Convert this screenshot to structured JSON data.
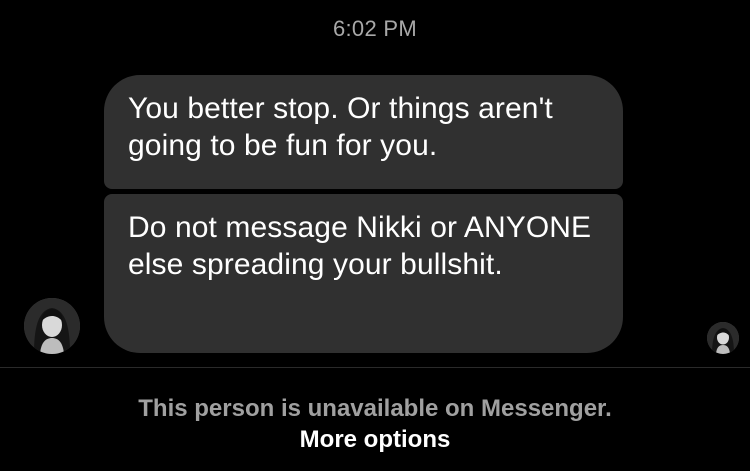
{
  "conversation": {
    "timestamp": "6:02 PM",
    "messages": [
      {
        "text": "You better stop. Or things aren't going to be fun for you."
      },
      {
        "text": "Do not message Nikki or ANYONE else spreading your bullshit."
      }
    ]
  },
  "footer": {
    "status": "This person is unavailable on Messenger.",
    "more_options": "More options"
  },
  "colors": {
    "background": "#000000",
    "bubble": "#303030",
    "timestamp": "#a8a8a8",
    "status_text": "#a0a0a0",
    "link_text": "#ffffff"
  }
}
